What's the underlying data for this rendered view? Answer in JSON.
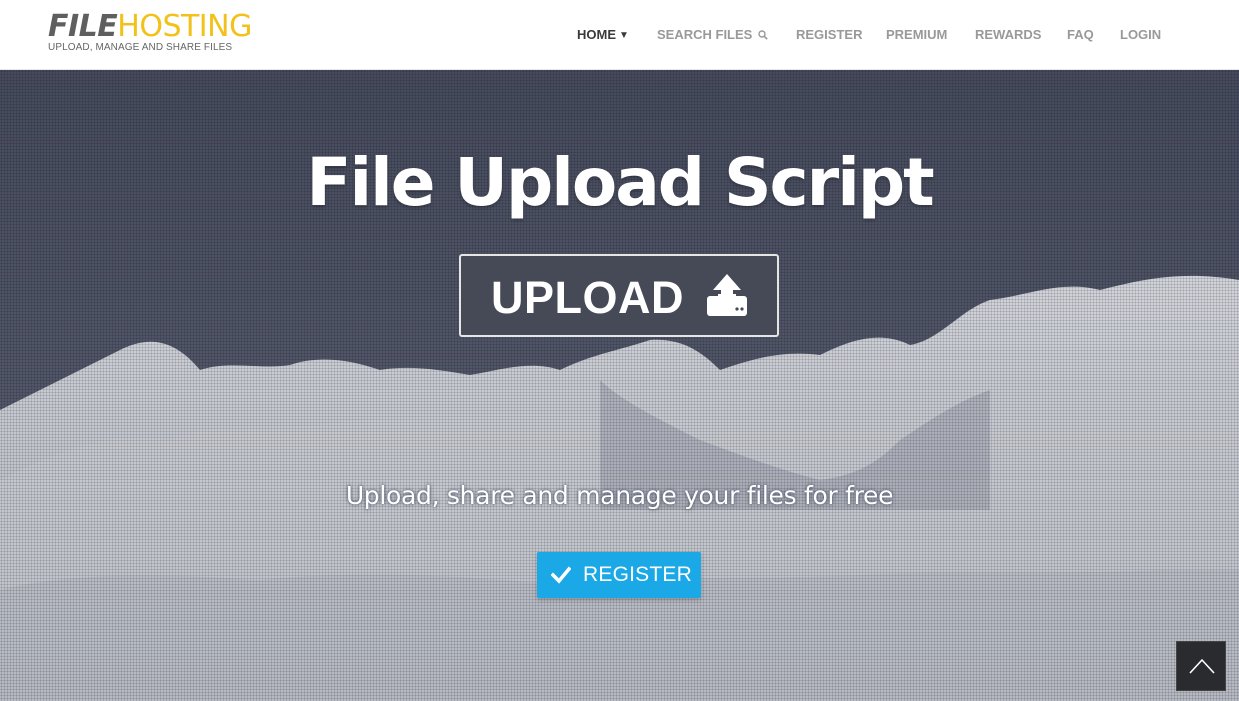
{
  "logo": {
    "title_part1": "FILE",
    "title_part2": "HOSTING",
    "tagline": "UPLOAD, MANAGE AND SHARE FILES",
    "colors": {
      "file": "#5f5f5f",
      "hosting": "#f2c21b"
    }
  },
  "nav": {
    "items": [
      {
        "label": "HOME",
        "icon": "caret-down-icon",
        "active": true
      },
      {
        "label": "SEARCH FILES",
        "icon": "search-icon",
        "active": false
      },
      {
        "label": "REGISTER",
        "active": false
      },
      {
        "label": "PREMIUM",
        "active": false
      },
      {
        "label": "REWARDS",
        "active": false
      },
      {
        "label": "FAQ",
        "active": false
      },
      {
        "label": "LOGIN",
        "active": false
      }
    ]
  },
  "hero": {
    "title": "File Upload Script",
    "upload_label": "UPLOAD",
    "upload_icon": "upload-icon",
    "tagline": "Upload, share and manage your files for free",
    "register_label": "REGISTER",
    "register_icon": "check-icon",
    "colors": {
      "upload_bg": "#454a56",
      "register_bg": "#1aa8e6"
    }
  },
  "scroll_top": {
    "icon": "chevron-up-icon"
  }
}
